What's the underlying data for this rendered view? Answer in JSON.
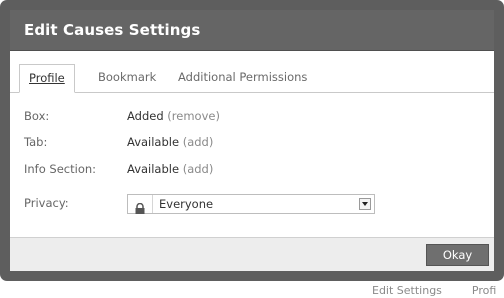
{
  "dialog": {
    "title": "Edit Causes Settings",
    "tabs": [
      {
        "label": "Profile",
        "active": true
      },
      {
        "label": "Bookmark",
        "active": false
      },
      {
        "label": "Additional Permissions",
        "active": false
      }
    ],
    "rows": [
      {
        "label": "Box:",
        "value": "Added",
        "action": "(remove)"
      },
      {
        "label": "Tab:",
        "value": "Available",
        "action": "(add)"
      },
      {
        "label": "Info Section:",
        "value": "Available",
        "action": "(add)"
      }
    ],
    "privacy": {
      "label": "Privacy:",
      "selected": "Everyone",
      "icon": "lock-icon"
    },
    "okay_label": "Okay"
  },
  "backdrop": {
    "items": [
      "Edit Settings",
      "Profi"
    ]
  },
  "colors": {
    "title_bar": "#656565",
    "frame": "#5e5e5e",
    "footer": "#ededed",
    "button": "#6f6f6f"
  }
}
